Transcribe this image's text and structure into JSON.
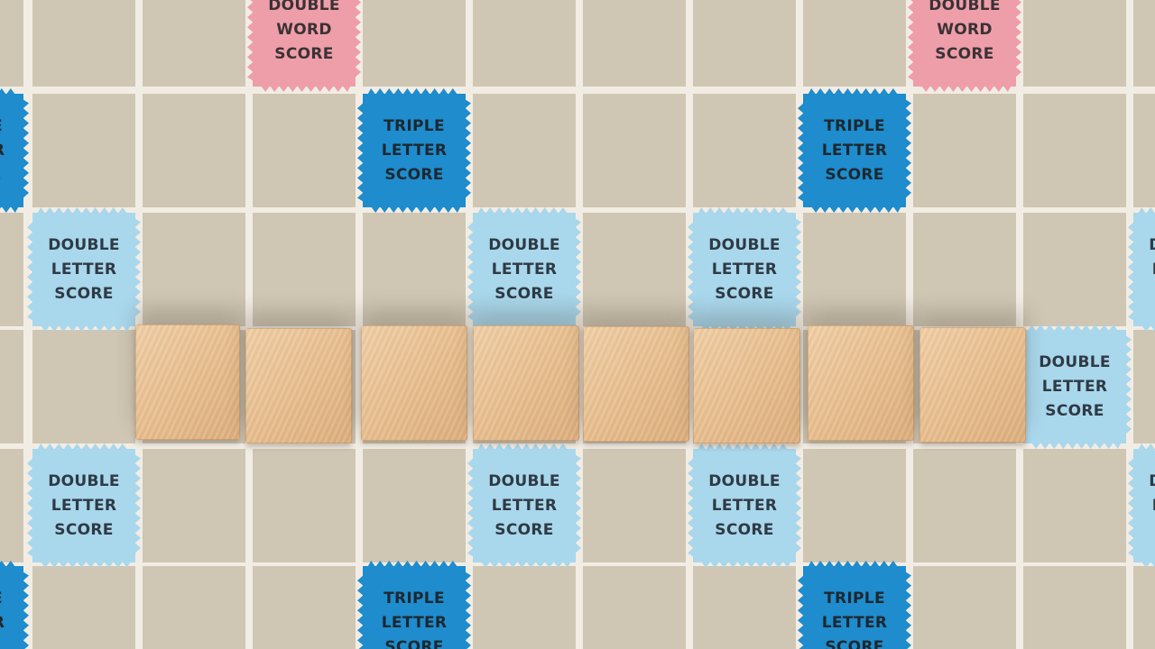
{
  "board": {
    "square_color": "#cfc6b4",
    "grid_line_color": "#f2ede4",
    "premium_colors": {
      "double_word": "#ee9ea8",
      "triple_letter": "#1e8ccd",
      "double_letter": "#a9d7ec"
    },
    "labels": {
      "double_word": [
        "DOUBLE",
        "WORD",
        "SCORE"
      ],
      "triple_letter": [
        "TRIPLE",
        "LETTER",
        "SCORE"
      ],
      "double_letter": [
        "DOUBLE",
        "LETTER",
        "SCORE"
      ]
    }
  },
  "tiles": {
    "count": 8,
    "faces": [
      "",
      "",
      "",
      "",
      "",
      "",
      "",
      ""
    ],
    "wood_color": "#e7bd8d"
  }
}
